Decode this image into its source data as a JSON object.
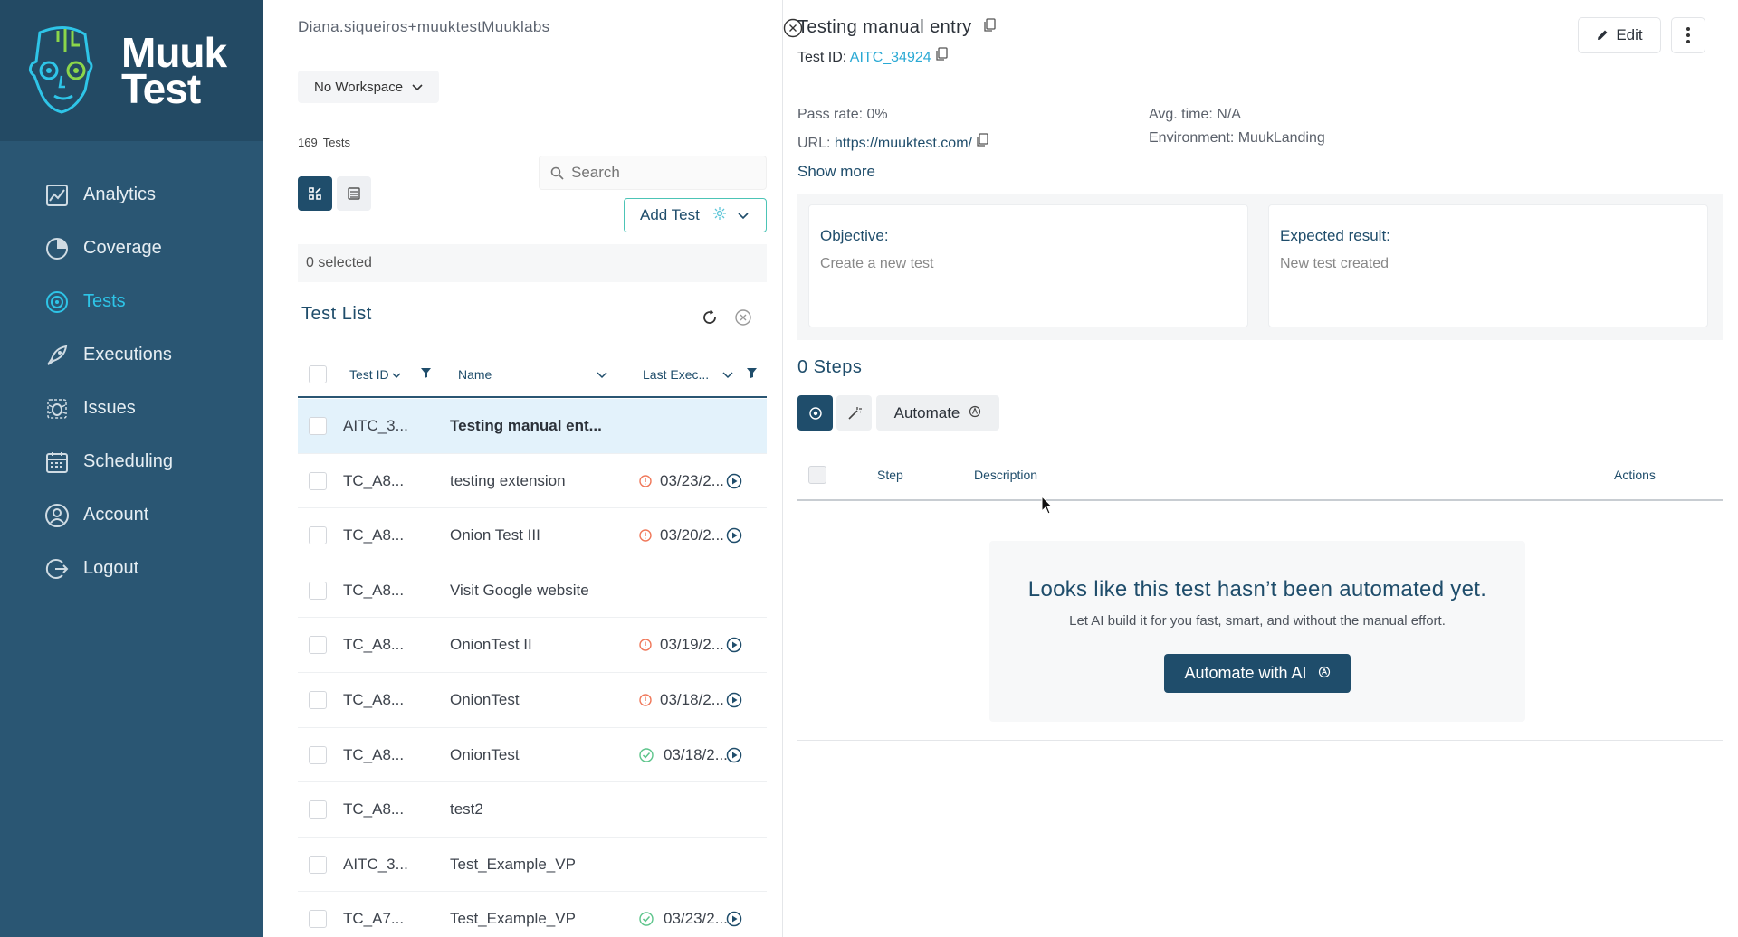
{
  "brand": {
    "line1": "Muuk",
    "line2": "Test",
    "accent": "#2ec5e8",
    "sidebar_bg": "#2a5673"
  },
  "nav": [
    {
      "label": "Analytics",
      "icon": "analytics-icon",
      "active": false
    },
    {
      "label": "Coverage",
      "icon": "coverage-icon",
      "active": false
    },
    {
      "label": "Tests",
      "icon": "tests-icon",
      "active": true
    },
    {
      "label": "Executions",
      "icon": "rocket-icon",
      "active": false
    },
    {
      "label": "Issues",
      "icon": "bug-icon",
      "active": false
    },
    {
      "label": "Scheduling",
      "icon": "calendar-icon",
      "active": false
    },
    {
      "label": "Account",
      "icon": "user-icon",
      "active": false
    },
    {
      "label": "Logout",
      "icon": "logout-icon",
      "active": false
    }
  ],
  "list": {
    "user": "Diana.siqueiros+muuktestMuuklabs",
    "workspace": "No Workspace",
    "count": "169",
    "count_label": "Tests",
    "search_placeholder": "Search",
    "add_test": "Add Test",
    "selected": "0 selected",
    "title": "Test List",
    "columns": {
      "id": "Test ID",
      "name": "Name",
      "last": "Last Exec..."
    },
    "rows": [
      {
        "id": "AITC_3...",
        "name": "Testing manual ent...",
        "status": "",
        "date": "",
        "selected": true
      },
      {
        "id": "TC_A8...",
        "name": "testing extension",
        "status": "warning",
        "date": "03/23/2...",
        "selected": false
      },
      {
        "id": "TC_A8...",
        "name": "Onion Test III",
        "status": "warning",
        "date": "03/20/2...",
        "selected": false
      },
      {
        "id": "TC_A8...",
        "name": "Visit Google website",
        "status": "",
        "date": "",
        "selected": false
      },
      {
        "id": "TC_A8...",
        "name": "OnionTest II",
        "status": "warning",
        "date": "03/19/2...",
        "selected": false
      },
      {
        "id": "TC_A8...",
        "name": "OnionTest",
        "status": "warning",
        "date": "03/18/2...",
        "selected": false
      },
      {
        "id": "TC_A8...",
        "name": "OnionTest",
        "status": "success",
        "date": "03/18/2...",
        "selected": false
      },
      {
        "id": "TC_A8...",
        "name": "test2",
        "status": "",
        "date": "",
        "selected": false
      },
      {
        "id": "AITC_3...",
        "name": "Test_Example_VP",
        "status": "",
        "date": "",
        "selected": false
      },
      {
        "id": "TC_A7...",
        "name": "Test_Example_VP",
        "status": "success",
        "date": "03/23/2...",
        "selected": false
      }
    ]
  },
  "detail": {
    "title": "Testing manual entry",
    "test_id_label": "Test ID:",
    "test_id": "AITC_34924",
    "edit": "Edit",
    "pass_rate": "Pass rate: 0%",
    "url_label": "URL:",
    "url": "https://muuktest.com/",
    "avg_time": "Avg. time: N/A",
    "environment": "Environment: MuukLanding",
    "show_more": "Show more",
    "objective_label": "Objective:",
    "objective": "Create a new test",
    "expected_label": "Expected result:",
    "expected": "New test created",
    "steps_title": "0 Steps",
    "automate": "Automate",
    "steps_cols": {
      "step": "Step",
      "description": "Description",
      "actions": "Actions"
    },
    "empty_title": "Looks like this test hasn’t been automated yet.",
    "empty_sub": "Let AI build it for you fast, smart, and without the manual effort.",
    "ai_button": "Automate with AI"
  }
}
